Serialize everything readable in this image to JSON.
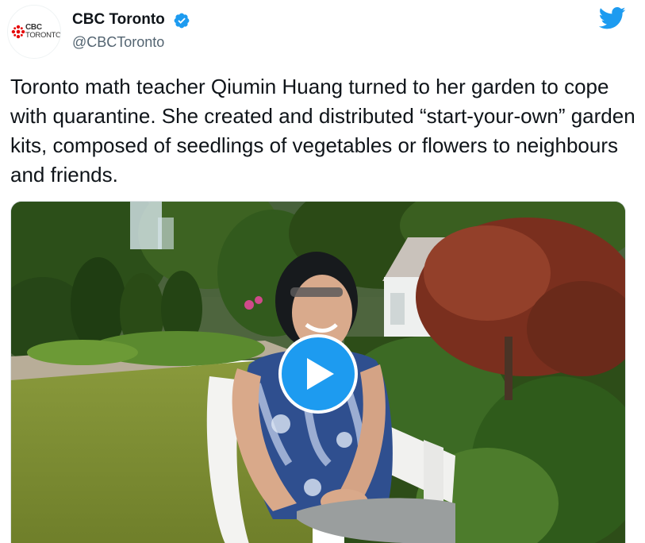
{
  "account": {
    "display_name": "CBC Toronto",
    "handle": "@CBCToronto",
    "verified": true,
    "avatar_logo_line1": "CBC",
    "avatar_logo_line2": "TORONTO"
  },
  "tweet": {
    "text": "Toronto math teacher Qiumin Huang turned to her garden to cope with quarantine. She created and distributed “start-your-own” garden kits, composed of seedlings of vegetables or flowers to neighbours and friends."
  },
  "media": {
    "type": "video",
    "play_icon": "play-icon"
  },
  "icons": {
    "brand": "twitter-bird-icon",
    "verified": "verified-badge-icon"
  },
  "colors": {
    "twitter_blue": "#1d9bf0",
    "text_primary": "#0f1419",
    "text_secondary": "#536471",
    "cbc_red": "#e60505"
  }
}
